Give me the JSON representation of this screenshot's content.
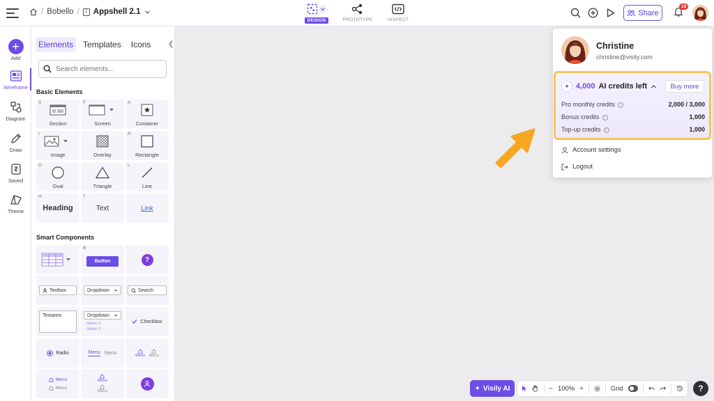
{
  "topbar": {
    "breadcrumb": {
      "team": "Bobello",
      "project": "Appshell 2.1",
      "file_icon_text": "1"
    },
    "modes": [
      {
        "label": "DESIGN",
        "active": true
      },
      {
        "label": "PROTOTYPE",
        "active": false
      },
      {
        "label": "INSPECT",
        "active": false
      }
    ],
    "share_label": "Share",
    "notification_count": "18",
    "icons": [
      "menu-icon",
      "home-icon",
      "search-icon",
      "add-circle-icon",
      "play-icon",
      "bell-icon"
    ]
  },
  "rail": {
    "items": [
      {
        "label": "Add",
        "icon": "plus-icon"
      },
      {
        "label": "Wireframe",
        "icon": "wireframe-icon",
        "active": true
      },
      {
        "label": "Diagram",
        "icon": "diagram-icon"
      },
      {
        "label": "Draw",
        "icon": "pen-icon"
      },
      {
        "label": "Saved",
        "icon": "saved-icon"
      },
      {
        "label": "Theme",
        "icon": "theme-icon"
      }
    ]
  },
  "panel": {
    "tabs": [
      {
        "label": "Elements",
        "active": true
      },
      {
        "label": "Templates",
        "active": false
      },
      {
        "label": "Icons",
        "active": false
      }
    ],
    "collapse_glyph": "❮",
    "search_placeholder": "Search elements...",
    "basic_title": "Basic Elements",
    "basic": [
      {
        "key": "S",
        "label": "Section"
      },
      {
        "key": "F",
        "label": "Screen"
      },
      {
        "key": "A",
        "label": "Container"
      },
      {
        "key": "I",
        "label": "Image"
      },
      {
        "key": "",
        "label": "Overlay"
      },
      {
        "key": "R",
        "label": "Rectangle"
      },
      {
        "key": "O",
        "label": "Oval"
      },
      {
        "key": "",
        "label": "Triangle"
      },
      {
        "key": "L",
        "label": "Line"
      },
      {
        "key": "H",
        "label": "Heading"
      },
      {
        "key": "T",
        "label": "Text"
      },
      {
        "key": "",
        "label": "Link"
      }
    ],
    "smart_title": "Smart Components",
    "smart": {
      "button_key": "B",
      "button_label": "Button",
      "textbox": "Textbox",
      "dropdown": "Dropdown",
      "search": "Search",
      "textarea": "Textarea",
      "dropdown2": "Dropdown",
      "option1": "Option 1",
      "option2": "Option 2",
      "checkbox": "Checkbox",
      "radio": "Radio",
      "menu_a": "Menu",
      "menu_b": "Menu",
      "menu_c": "Menu",
      "menu_d": "Menu",
      "menu_e": "Menu",
      "menu_f": "Menu",
      "menu_g": "Menu",
      "menu_h": "Menu"
    }
  },
  "account": {
    "name": "Christine",
    "email": "christine@visily.com",
    "credits_count": "4,000",
    "credits_suffix": "AI credits left",
    "buy_more": "Buy more",
    "rows": [
      {
        "label": "Pro monthly credits",
        "value": "2,000 / 3,000"
      },
      {
        "label": "Bonus credits",
        "value": "1,000"
      },
      {
        "label": "Top-up credits",
        "value": "1,000"
      }
    ],
    "menu": [
      {
        "label": "Account settings",
        "icon": "user-icon"
      },
      {
        "label": "Logout",
        "icon": "logout-icon"
      }
    ]
  },
  "bottombar": {
    "ai_label": "Visily AI",
    "zoom": "100%",
    "grid_label": "Grid",
    "help": "?"
  },
  "colors": {
    "accent": "#6b4de6",
    "highlight": "#f7c45a",
    "arrow": "#f5a623"
  }
}
